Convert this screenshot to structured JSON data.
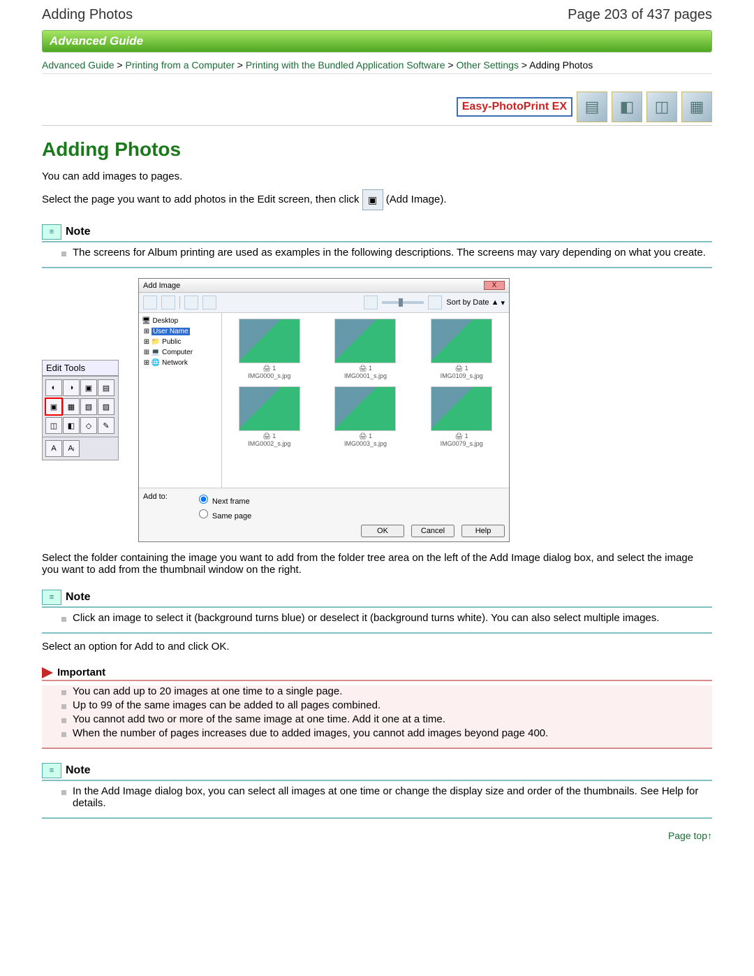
{
  "header": {
    "title": "Adding Photos",
    "pageinfo": "Page 203 of 437 pages"
  },
  "guide": {
    "label": "Advanced Guide"
  },
  "breadcrumb": {
    "items": [
      "Advanced Guide",
      "Printing from a Computer",
      "Printing with the Bundled Application Software",
      "Other Settings",
      "Adding Photos"
    ],
    "sep": " > "
  },
  "logo": {
    "text": "Easy-PhotoPrint ",
    "em": "EX"
  },
  "h1": "Adding Photos",
  "p1": "You can add images to pages.",
  "p2a": "Select the page you want to add photos in the Edit screen, then click ",
  "p2b": " (Add Image).",
  "note1": {
    "label": "Note",
    "items": [
      "The screens for Album printing are used as examples in the following descriptions. The screens may vary depending on what you create."
    ]
  },
  "edit_tools": {
    "title": "Edit Tools"
  },
  "dialog": {
    "title": "Add Image",
    "close": "X",
    "sort_label": "Sort by Date ▲",
    "tree": {
      "root": "Desktop",
      "user": "User Name",
      "public": "Public",
      "computer": "Computer",
      "network": "Network"
    },
    "thumbs": [
      "IMG0000_s.jpg",
      "IMG0001_s.jpg",
      "IMG0109_s.jpg",
      "IMG0002_s.jpg",
      "IMG0003_s.jpg",
      "IMG0079_s.jpg"
    ],
    "copies": "1",
    "addto_label": "Add to:",
    "opt_next": "Next frame",
    "opt_same": "Same page",
    "btn_ok": "OK",
    "btn_cancel": "Cancel",
    "btn_help": "Help"
  },
  "p3": "Select the folder containing the image you want to add from the folder tree area on the left of the Add Image dialog box, and select the image you want to add from the thumbnail window on the right.",
  "note2": {
    "label": "Note",
    "items": [
      "Click an image to select it (background turns blue) or deselect it (background turns white). You can also select multiple images."
    ]
  },
  "p4": "Select an option for Add to and click OK.",
  "important": {
    "label": "Important",
    "items": [
      "You can add up to 20 images at one time to a single page.",
      "Up to 99 of the same images can be added to all pages combined.",
      "You cannot add two or more of the same image at one time. Add it one at a time.",
      "When the number of pages increases due to added images, you cannot add images beyond page 400."
    ]
  },
  "note3": {
    "label": "Note",
    "items": [
      "In the Add Image dialog box, you can select all images at one time or change the display size and order of the thumbnails. See Help for details."
    ]
  },
  "pagetop": "Page top↑"
}
